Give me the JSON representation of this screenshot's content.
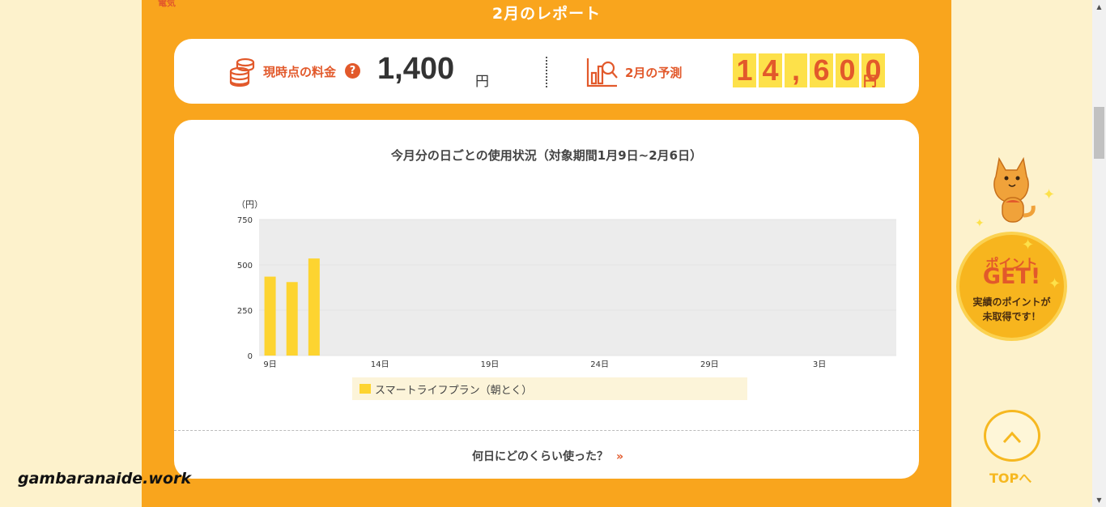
{
  "header": {
    "section_label": "電気",
    "report_title": "2月のレポート"
  },
  "summary": {
    "current_label": "現時点の料金",
    "help": "?",
    "current_value": "1,400",
    "yen": "円",
    "forecast_label": "2月の予測",
    "forecast_digits": [
      "1",
      "4",
      ",",
      "6",
      "0",
      "0"
    ],
    "forecast_value": "14,600",
    "yen2": "円"
  },
  "chart_data": {
    "type": "bar",
    "title": "今月分の日ごとの使用状況（対象期間1月9日~2月6日）",
    "ylabel": "（円）",
    "ylim": [
      0,
      750
    ],
    "yticks": [
      0,
      250,
      500,
      750
    ],
    "xtick_labels": [
      "9日",
      "14日",
      "19日",
      "24日",
      "29日",
      "3日"
    ],
    "categories": [
      "9日",
      "10日",
      "11日"
    ],
    "series": [
      {
        "name": "スマートライフプラン（朝とく）",
        "color": "#fdd430",
        "values": [
          435,
          405,
          535
        ]
      }
    ],
    "total_days": 29,
    "legend": "bottom",
    "plot_background": "#ececec"
  },
  "footer_link": {
    "label": "何日にどのくらい使った？",
    "arrow": "»"
  },
  "side": {
    "point_line1": "ポイント",
    "point_line2": "GET!",
    "point_line3a": "実績のポイントが",
    "point_line3b": "未取得です！",
    "top_label": "TOPへ"
  },
  "watermark": "gambaranaide.work",
  "colors": {
    "accent": "#f9a51d",
    "orange_text": "#e2592b",
    "bar": "#fdd430",
    "digit_bg": "#fde14a"
  }
}
